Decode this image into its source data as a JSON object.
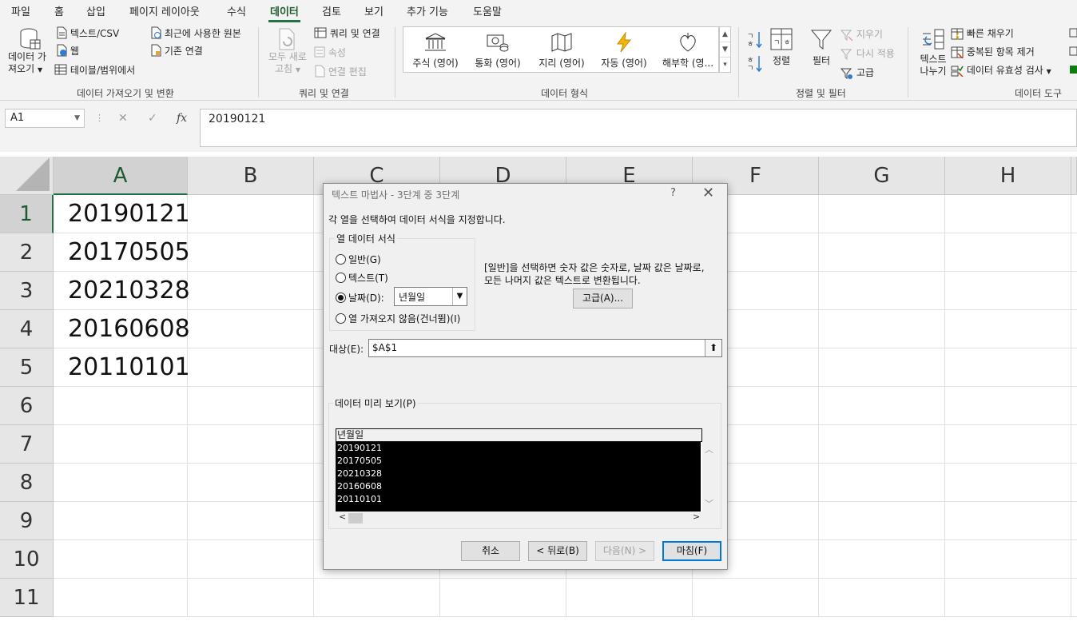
{
  "menu": {
    "tabs": [
      "파일",
      "홈",
      "삽입",
      "페이지 레이아웃",
      "수식",
      "데이터",
      "검토",
      "보기",
      "추가 기능",
      "도움말"
    ],
    "active_tab": "데이터"
  },
  "ribbon": {
    "get_data": {
      "line1": "데이터 가",
      "line2": "져오기"
    },
    "text_csv": "텍스트/CSV",
    "web": "웹",
    "table_range": "테이블/범위에서",
    "recent_sources": "최근에 사용한 원본",
    "existing_connections": "기존 연결",
    "group_get_transform": "데이터 가져오기 및 변환",
    "refresh_all": {
      "line1": "모두 새로",
      "line2": "고침"
    },
    "queries_connections": "쿼리 및 연결",
    "properties": "속성",
    "edit_links": "연결 편집",
    "group_queries": "쿼리 및 연결",
    "data_types": [
      "주식 (영어)",
      "통화 (영어)",
      "지리 (영어)",
      "자동 (영어)",
      "해부학 (영..."
    ],
    "group_data_types": "데이터 형식",
    "sort": "정렬",
    "filter": "필터",
    "clear": "지우기",
    "reapply": "다시 적용",
    "advanced": "고급",
    "group_sort_filter": "정렬 및 필터",
    "text_to_columns": {
      "line1": "텍스트",
      "line2": "나누기"
    },
    "flash_fill": "빠른 채우기",
    "remove_duplicates": "중복된 항목 제거",
    "data_validation": "데이터 유효성 검사",
    "group_data_tools": "데이터 도구",
    "accent": "#217346"
  },
  "formula_bar": {
    "name_box": "A1",
    "formula": "20190121",
    "cancel_symbol": "✕",
    "enter_symbol": "✓",
    "fx_symbol": "fx"
  },
  "sheet": {
    "columns": [
      "A",
      "B",
      "C",
      "D",
      "E",
      "F",
      "G",
      "H"
    ],
    "rows": [
      "1",
      "2",
      "3",
      "4",
      "5",
      "6",
      "7",
      "8",
      "9",
      "10",
      "11"
    ],
    "column_a_values": [
      "20190121",
      "20170505",
      "20210328",
      "20160608",
      "20110101"
    ]
  },
  "dialog": {
    "title": "텍스트 마법사 - 3단계 중 3단계",
    "help_symbol": "?",
    "close_symbol": "✕",
    "description": "각 열을 선택하여 데이터 서식을 지정합니다.",
    "group_label": "열 데이터 서식",
    "options": [
      "일반(G)",
      "텍스트(T)",
      "날짜(D):",
      "열 가져오지 않음(건너뜀)(I)"
    ],
    "selected_option": "날짜(D):",
    "date_format": "년월일",
    "info_line1": "[일반]을 선택하면 숫자 값은 숫자로, 날짜 값은 날짜로,",
    "info_line2": "모든 나머지 값은 텍스트로 변환됩니다.",
    "advanced_button": "고급(A)...",
    "destination_label": "대상(E):",
    "destination_value": "$A$1",
    "preview_label": "데이터 미리 보기(P)",
    "preview_header": "년월일",
    "preview_rows": [
      "20190121",
      "20170505",
      "20210328",
      "20160608",
      "20110101"
    ],
    "buttons": {
      "cancel": "취소",
      "back": "< 뒤로(B)",
      "next": "다음(N) >",
      "finish": "마침(F)"
    }
  }
}
